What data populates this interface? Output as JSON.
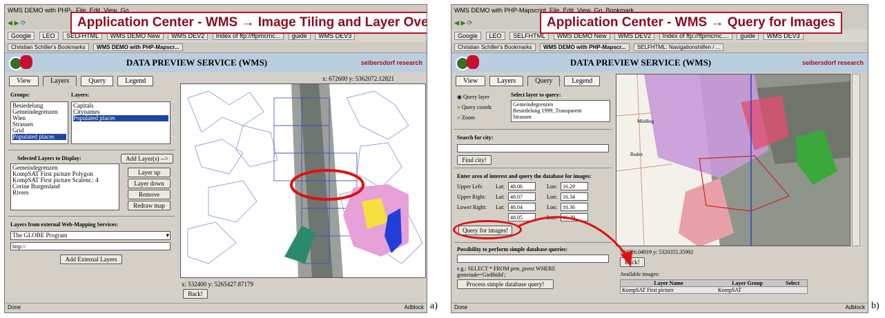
{
  "panel_a": {
    "window_title": "WMS DEMO with PHP-",
    "menu": [
      "File",
      "Edit",
      "View",
      "Go"
    ],
    "overlay_title": "Application Center - WMS → Image Tiling and Layer Overlays",
    "bookmarks": [
      "Google",
      "LEO",
      "SELFHTML",
      "WMS DEMO New",
      "WMS DEV2",
      "Index of ftp://ftpmcmc...",
      "guide",
      "WMS DEV3"
    ],
    "tabs_bar": [
      "Christian Schiller's Bookmarks",
      "WMS DEMO with PHP-Mapscr..."
    ],
    "app_title": "DATA PREVIEW SERVICE (WMS)",
    "brand": "seibersdorf research",
    "tabs": [
      "View",
      "Layers",
      "Query",
      "Legend"
    ],
    "groups_label": "Groups:",
    "groups": [
      "Besiedelung",
      "Gemeindegrenzen",
      "Wien",
      "Strassen",
      "Grid",
      "Populated places"
    ],
    "layers_label": "Layers:",
    "layers": [
      "Capitals",
      "Citynames",
      "Populated places"
    ],
    "selected_label": "Selected Layers to Display:",
    "selected_layers": [
      "Gemeindegrenzen",
      "KompSAT First picture Polygon",
      "KompSAT First picture Scalenr.: 4",
      "Corine Burgenland",
      "Rivers"
    ],
    "buttons": {
      "add": "Add Layer(s) -->",
      "up": "Layer up",
      "down": "Layer down",
      "remove": "Remove",
      "redraw": "Redraw map",
      "back": "Back!",
      "add_external": "Add External Layers"
    },
    "external_label": "Layers from external Web-Mapping Services:",
    "external_select": "The GLOBE Program",
    "external_url": "http://",
    "coord_top": "x: 672600 y: 5362072.12821",
    "coord_bottom": "x: 532400 y: 5265427.87179",
    "status": "Done",
    "adblock": "Adblock",
    "caption": "a)"
  },
  "panel_b": {
    "window_title": "WMS DEMO with PHP-Mapscript",
    "menu": [
      "File",
      "Edit",
      "View",
      "Go",
      "Bookmark"
    ],
    "overlay_title": "Application Center - WMS → Query for Images",
    "bookmarks": [
      "Google",
      "LEO",
      "SELFHTML",
      "WMS DEMO New",
      "WMS DEV2",
      "Index of ftp://ftpmcmc....",
      "guide",
      "WMS DEV3"
    ],
    "tabs_bar": [
      "Christian Schiller's Bookmarks",
      "WMS DEMO with PHP-Mapscr...",
      "SELFHTML: Navigationshilfen / ..."
    ],
    "app_title": "DATA PREVIEW SERVICE (WMS)",
    "brand": "seibersdorf research",
    "tabs": [
      "View",
      "Layers",
      "Query",
      "Legend"
    ],
    "radios": [
      "Query layer",
      "Query coords",
      "Zoom"
    ],
    "select_layer_label": "Select layer to query:",
    "query_layers": [
      "Gemeindegrenzen",
      "Besiedelung 1999_Transparent",
      "Strassen"
    ],
    "search_label": "Search for city:",
    "find_button": "Find city!",
    "area_label": "Enter area of interest and query the database for images:",
    "area_rows": [
      {
        "name": "Upper Left:",
        "lat_label": "Lat:",
        "lat": "48.06",
        "lon_label": "Lon:",
        "lon": "16.29"
      },
      {
        "name": "Upper Right:",
        "lat_label": "Lat:",
        "lat": "48.07",
        "lon_label": "Lon:",
        "lon": "16.34"
      },
      {
        "name": "Lower Right:",
        "lat_label": "Lat:",
        "lat": "48.04",
        "lon_label": "Lon:",
        "lon": "16.36"
      },
      {
        "name": "",
        "lat_label": "",
        "lat": "48.05",
        "lon_label": "Lon:",
        "lon": "16.29"
      }
    ],
    "query_images_button": "Query for images!",
    "db_label": "Possibility to perform simple database queries:",
    "db_example": "e.g.: SELECT * FROM prm_prenz WHERE gemeinde='Gießhübl';",
    "db_button": "Process simple database query!",
    "coord_bottom": "594226.04919 y: 5320355.35992",
    "back_button": "Back!",
    "available_label": "Available images:",
    "table_headers": [
      "Layer Name",
      "Layer Group",
      "Select"
    ],
    "table_rows": [
      [
        "KompSAT First picture",
        "KompSAT",
        ""
      ]
    ],
    "map_places": [
      "Mödling",
      "Baden"
    ],
    "status": "Done",
    "adblock": "Adblock",
    "caption": "b)"
  },
  "colors": {
    "title_red": "#b3122b",
    "header_blue": "#b9cfe0",
    "selection": "#1e46a0",
    "highlight_red": "#e01010"
  }
}
